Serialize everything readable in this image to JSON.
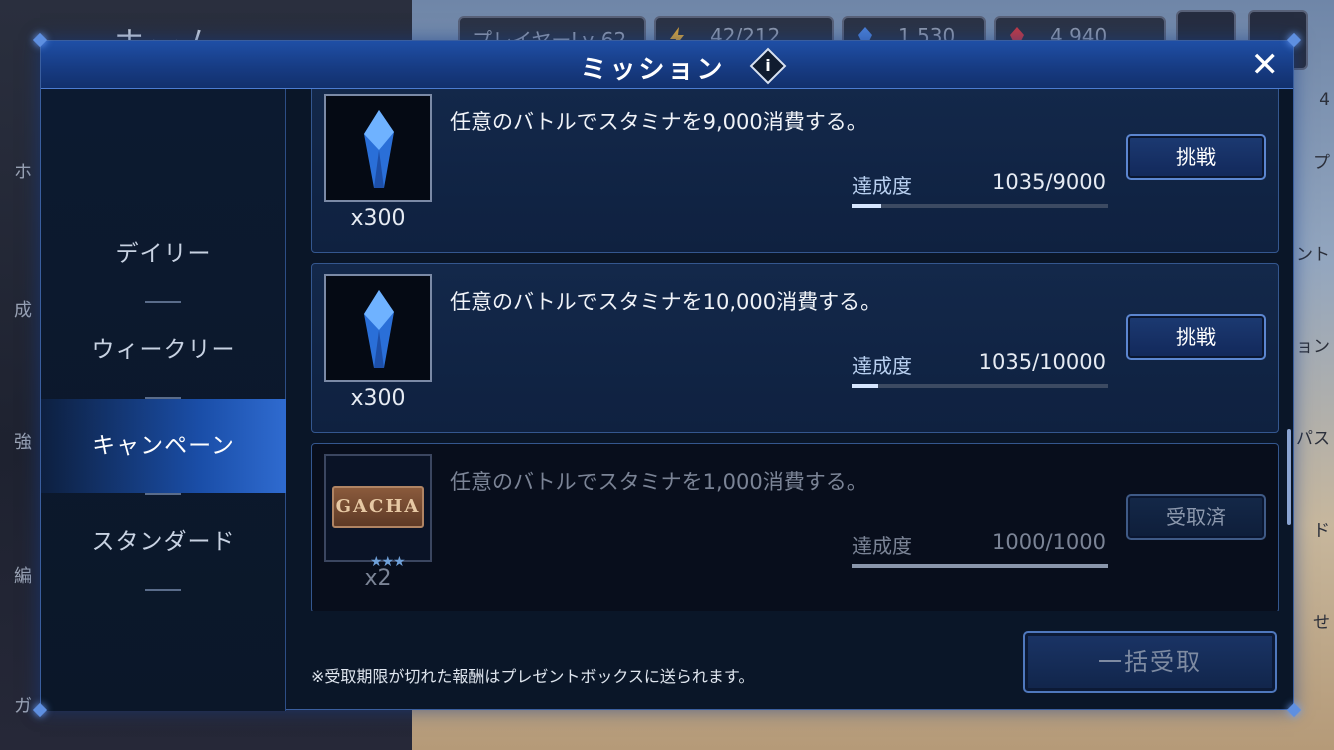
{
  "background": {
    "home_title": "ホーム",
    "status": {
      "player_level": "プレイヤーLv 62",
      "stamina": "42/212",
      "blue_crystals": "1,530",
      "red_crystals": "4,940"
    },
    "sidebar_labels": [
      "ホ",
      "成",
      "強",
      "編",
      "ガ"
    ],
    "right_labels": [
      "プ",
      "ント",
      "ョン",
      "パス",
      "ド",
      "せ"
    ],
    "badge_number": "4"
  },
  "modal": {
    "title": "ミッション",
    "info_glyph": "i",
    "close_glyph": "✕"
  },
  "tabs": [
    {
      "label": "デイリー",
      "active": false
    },
    {
      "label": "ウィークリー",
      "active": false
    },
    {
      "label": "キャンペーン",
      "active": true
    },
    {
      "label": "スタンダード",
      "active": false
    }
  ],
  "missions": [
    {
      "reward_icon": "blue-crystal-icon",
      "reward_qty": "x300",
      "description": "任意のバトルでスタミナを9,000消費する。",
      "progress_label": "達成度",
      "progress_text": "1035/9000",
      "progress_fraction": 0.115,
      "button_label": "挑戦",
      "completed": false
    },
    {
      "reward_icon": "blue-crystal-icon",
      "reward_qty": "x300",
      "description": "任意のバトルでスタミナを10,000消費する。",
      "progress_label": "達成度",
      "progress_text": "1035/10000",
      "progress_fraction": 0.1035,
      "button_label": "挑戦",
      "completed": false
    },
    {
      "reward_icon": "gacha-ticket-icon",
      "reward_image_text": "GACHA",
      "reward_stars": "★★★",
      "reward_qty": "x2",
      "description": "任意のバトルでスタミナを1,000消費する。",
      "progress_label": "達成度",
      "progress_text": "1000/1000",
      "progress_fraction": 1.0,
      "button_label": "受取済",
      "completed": true
    }
  ],
  "footer": {
    "note": "※受取期限が切れた報酬はプレゼントボックスに送られます。",
    "claim_all_label": "一括受取"
  },
  "colors": {
    "modal_header": "#173c84",
    "active_tab": "#2f6bd0",
    "panel_bg": "#0a1628"
  }
}
